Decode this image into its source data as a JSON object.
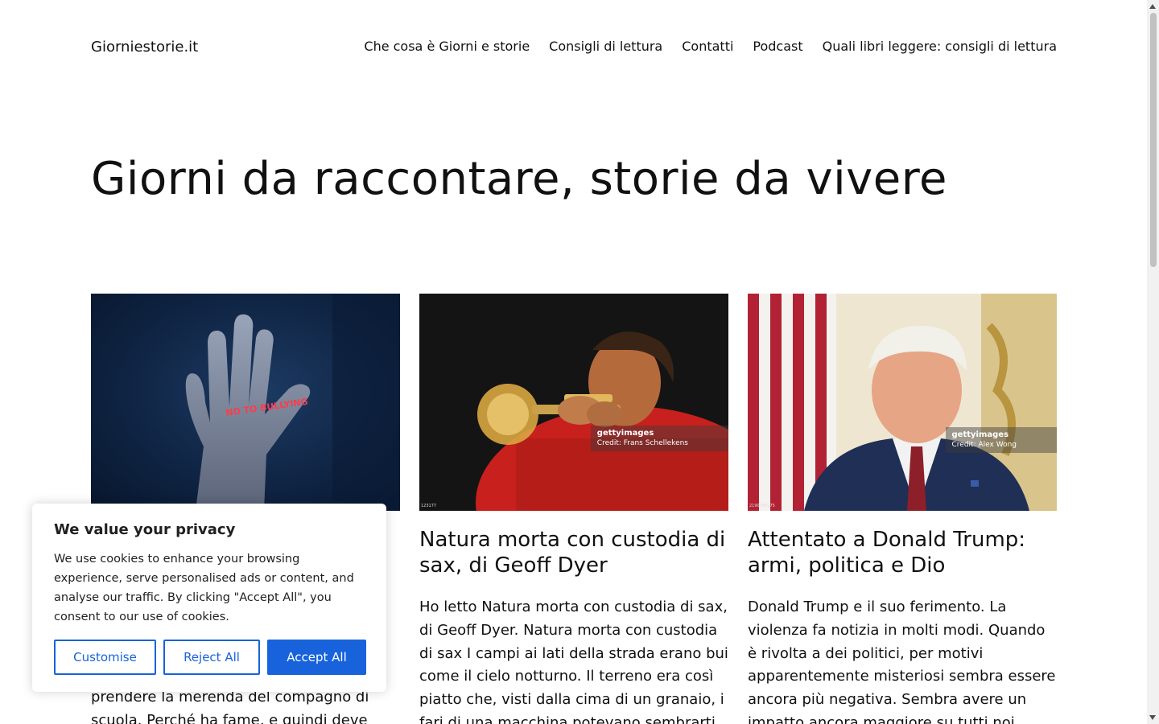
{
  "site": {
    "title": "Giorniestorie.it"
  },
  "nav": [
    {
      "label": "Che cosa è Giorni e storie"
    },
    {
      "label": "Consigli di lettura"
    },
    {
      "label": "Contatti"
    },
    {
      "label": "Podcast"
    },
    {
      "label": "Quali libri leggere: consigli di lettura"
    }
  ],
  "hero": {
    "title": "Giorni da raccontare, storie da vivere"
  },
  "posts": [
    {
      "image_text": "NO TO BULLYING",
      "excerpt_visible": "prendere la merenda del compagno di scuola. Perché ha fame, e quindi deve"
    },
    {
      "title": "Natura morta con custodia di sax, di Geoff Dyer",
      "excerpt": "Ho letto Natura morta con custodia di sax, di Geoff Dyer. Natura morta con custodia di sax I campi ai lati della strada erano bui come il cielo notturno. Il terreno era così piatto che, visti dalla cima di un granaio, i fari di una macchina potevano sembrarti",
      "credit_brand": "gettyimages",
      "credit": "Credit: Frans Schellekens",
      "id_text": "123177"
    },
    {
      "title": "Attentato a Donald Trump: armi, politica e Dio",
      "excerpt": "Donald Trump e il suo ferimento. La violenza fa notizia in molti modi. Quando è rivolta a dei politici, per motivi apparentemente misteriosi sembra essere ancora più negativa. Sembra avere un impatto ancora maggiore su tutti noi",
      "credit_brand": "gettyimages",
      "credit": "Credit: Alex Wong",
      "id_text": "2190799175"
    }
  ],
  "cookie": {
    "title": "We value your privacy",
    "text": "We use cookies to enhance your browsing experience, serve personalised ads or content, and analyse our traffic. By clicking \"Accept All\", you consent to our use of cookies.",
    "customise": "Customise",
    "reject": "Reject All",
    "accept": "Accept All"
  },
  "colors": {
    "accent": "#1863dc",
    "text": "#111111",
    "background": "#ffffff"
  }
}
